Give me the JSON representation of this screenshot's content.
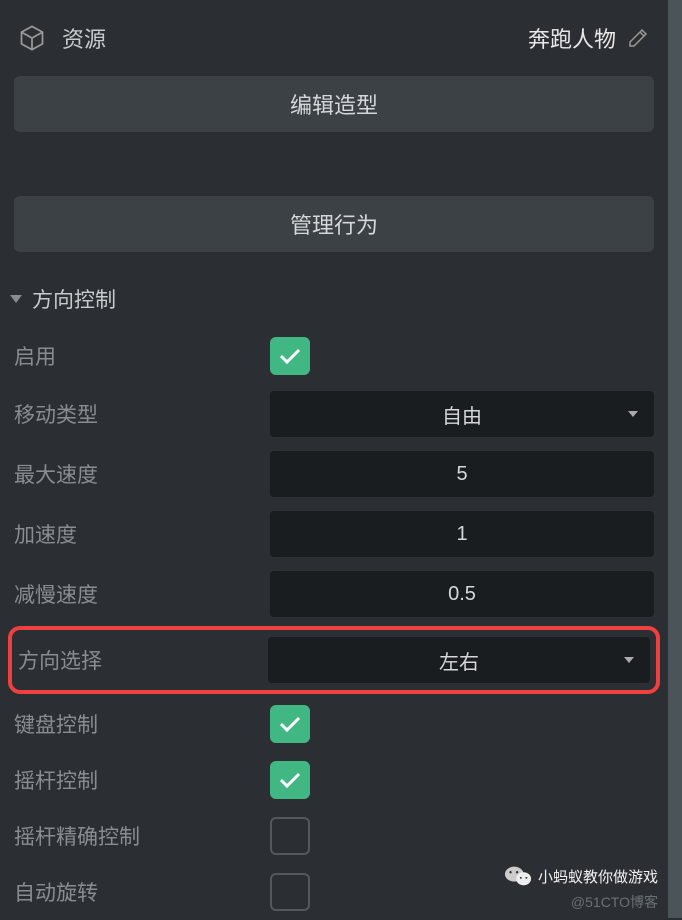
{
  "header": {
    "title": "资源",
    "object_name": "奔跑人物"
  },
  "buttons": {
    "edit_shape": "编辑造型",
    "manage_behavior": "管理行为"
  },
  "section": {
    "title": "方向控制"
  },
  "props": {
    "enable": {
      "label": "启用",
      "value": true
    },
    "move_type": {
      "label": "移动类型",
      "value": "自由"
    },
    "max_speed": {
      "label": "最大速度",
      "value": "5"
    },
    "accel": {
      "label": "加速度",
      "value": "1"
    },
    "decel": {
      "label": "减慢速度",
      "value": "0.5"
    },
    "direction": {
      "label": "方向选择",
      "value": "左右"
    },
    "keyboard": {
      "label": "键盘控制",
      "value": true
    },
    "joystick": {
      "label": "摇杆控制",
      "value": true
    },
    "joystick_precise": {
      "label": "摇杆精确控制",
      "value": false
    },
    "auto_rotate": {
      "label": "自动旋转",
      "value": false
    }
  },
  "footer": {
    "badge": "小蚂蚁教你做游戏",
    "watermark": "@51CTO博客"
  }
}
